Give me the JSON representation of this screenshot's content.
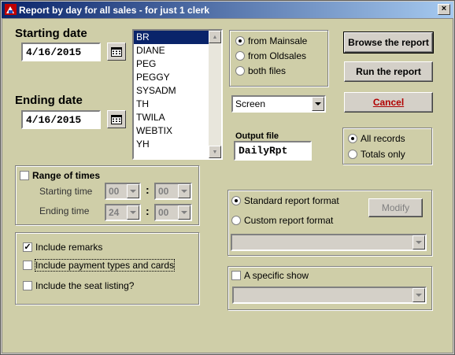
{
  "window": {
    "title": "Report by day for all sales - for just 1 clerk",
    "close": "×"
  },
  "starting_date": {
    "label": "Starting date",
    "value": "4/16/2015"
  },
  "ending_date": {
    "label": "Ending date",
    "value": "4/16/2015"
  },
  "clerks": [
    "BR",
    "DIANE",
    "PEG",
    "PEGGY",
    "SYSADM",
    "TH",
    "TWILA",
    "WEBTIX",
    "YH"
  ],
  "selected_clerk": "BR",
  "source": {
    "options": [
      "from Mainsale",
      "from Oldsales",
      "both files"
    ],
    "selected": 0
  },
  "buttons": {
    "browse": "Browse the report",
    "run": "Run the report",
    "cancel": "Cancel",
    "modify": "Modify"
  },
  "output_device": "Screen",
  "output_file": {
    "label": "Output file",
    "value": "DailyRpt"
  },
  "records": {
    "options": [
      "All records",
      "Totals only"
    ],
    "selected": 0
  },
  "times": {
    "label": "Range of times",
    "start_label": "Starting time",
    "end_label": "Ending time",
    "start_hour": "00",
    "start_min": "00",
    "end_hour": "24",
    "end_min": "00",
    "sep": ":"
  },
  "format": {
    "standard": "Standard report format",
    "custom": "Custom report format",
    "selected": "standard"
  },
  "options": {
    "remarks": "Include remarks",
    "payments": "Include payment types and cards",
    "seats": "Include the seat listing?"
  },
  "show": {
    "label": "A specific show"
  }
}
